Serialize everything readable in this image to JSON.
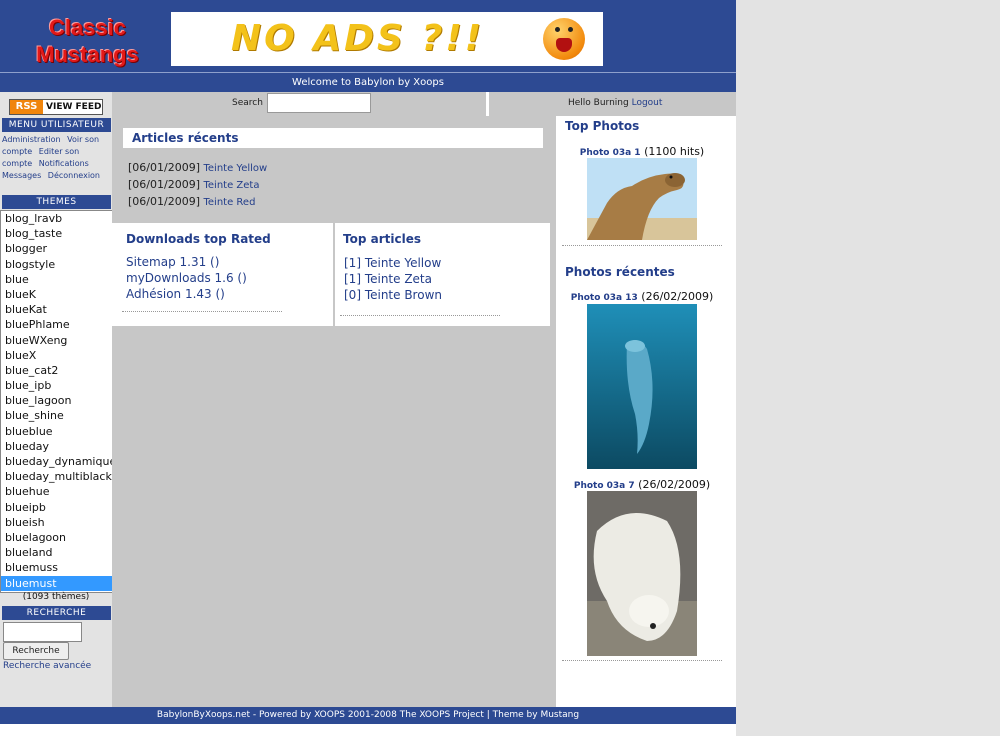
{
  "header": {
    "logo_line1": "Classic",
    "logo_line2": "Mustangs",
    "banner_text": "NO ADS ?!!",
    "welcome": "Welcome to Babylon by Xoops"
  },
  "userbar": {
    "search_label": "Search",
    "search_value": "",
    "hello_text": "Hello Burning",
    "logout_label": "Logout"
  },
  "left": {
    "rss_label": "RSS",
    "view_feed_label": "VIEW FEED",
    "user_menu_title": "MENU UTILISATEUR",
    "user_menu_items": [
      "Administration",
      "Voir son compte",
      "Editer son compte",
      "Notifications",
      "Messages",
      "Déconnexion"
    ],
    "themes_title": "THEMES",
    "themes": [
      "blog_lravb",
      "blog_taste",
      "blogger",
      "blogstyle",
      "blue",
      "blueK",
      "blueKat",
      "bluePhlame",
      "blueWXeng",
      "blueX",
      "blue_cat2",
      "blue_ipb",
      "blue_lagoon",
      "blue_shine",
      "blueblue",
      "blueday",
      "blueday_dynamique",
      "blueday_multiblack",
      "bluehue",
      "blueipb",
      "blueish",
      "bluelagoon",
      "blueland",
      "bluemuss",
      "bluemust"
    ],
    "selected_theme": "bluemust",
    "themes_count": "(1093 thèmes)",
    "search_title": "RECHERCHE",
    "search_button": "Recherche",
    "advanced_search": "Recherche avancée"
  },
  "center": {
    "recent_title": "Articles récents",
    "recent_articles": [
      {
        "date": "[06/01/2009]",
        "title": "Teinte Yellow"
      },
      {
        "date": "[06/01/2009]",
        "title": "Teinte Zeta"
      },
      {
        "date": "[06/01/2009]",
        "title": "Teinte Red"
      }
    ],
    "downloads_title": "Downloads top Rated",
    "downloads": [
      "Sitemap 1.31 ()",
      "myDownloads 1.6 ()",
      "Adhésion 1.43 ()"
    ],
    "top_articles_title": "Top articles",
    "top_articles": [
      "[1] Teinte Yellow",
      "[1] Teinte Zeta",
      "[0] Teinte Brown"
    ]
  },
  "right": {
    "top_photos_title": "Top Photos",
    "top_photo": {
      "name": "Photo 03a 1",
      "info": "(1100 hits)"
    },
    "recent_photos_title": "Photos récentes",
    "recent_photos": [
      {
        "name": "Photo 03a 13",
        "info": "(26/02/2009)"
      },
      {
        "name": "Photo 03a 7",
        "info": "(26/02/2009)"
      }
    ]
  },
  "footer": {
    "text": "BabylonByXoops.net - Powered by XOOPS 2001-2008 The XOOPS Project | Theme by Mustang"
  },
  "colors": {
    "header_blue": "#2d4a93",
    "link_blue": "#233e8a",
    "selection_blue": "#3399ff",
    "logo_red": "#e21919",
    "panel_grey": "#c7c7c7"
  }
}
